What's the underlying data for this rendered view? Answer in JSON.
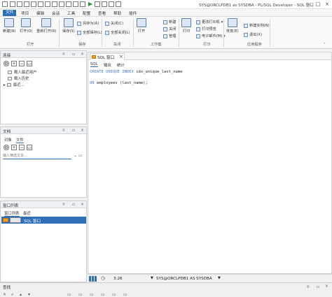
{
  "title": "SYS@ORCLPDB1 as SYSDBA - PL/SQL Developer - SQL 窗口",
  "menu": [
    "文件",
    "项目",
    "编辑",
    "会话",
    "工具",
    "配置",
    "查看",
    "帮助",
    "插件"
  ],
  "ribbon": {
    "new": "新建(N)",
    "open": "打开(O)",
    "reopen": "重新打开(R)",
    "save": "保存(S)",
    "save_as": "另存为(A)",
    "save_all": "全部保存(L)",
    "close": "关闭(C)",
    "close_all": "全部关闭(L)",
    "wb_open": "打开",
    "wb_new": "新建",
    "wb_close": "关闭",
    "wb_manage": "管理",
    "print": "打印",
    "change_printer": "更改打印机",
    "print_preview": "打印预览",
    "email": "电子邮件(M)",
    "recover": "恢复(E)",
    "new_instance": "新建实例(N)",
    "exit": "退出(X)",
    "groups": {
      "open": "打开",
      "save": "保存",
      "close": "关闭",
      "workspace": "工作集",
      "print": "打印",
      "app": "应用程序"
    }
  },
  "browser_panel": {
    "title": "连接",
    "items": [
      "载入最近用户",
      "载入历史",
      "最近..."
    ]
  },
  "files_panel": {
    "title": "文档",
    "tabs": [
      "对象",
      "文件"
    ],
    "filter_placeholder": "输入筛选文本..."
  },
  "window_list_panel": {
    "title": "窗口列表",
    "tabs": [
      "窗口列表",
      "最近"
    ],
    "items": [
      {
        "label": "SQL 窗口",
        "selected": true
      }
    ]
  },
  "editor": {
    "doc_tab": "SQL 窗口",
    "subtabs": [
      "SQL",
      "输出",
      "统计"
    ],
    "lines": [
      [
        "CREATE UNIQUE INDEX",
        " idx_unique_last_name"
      ],
      [
        "",
        ""
      ],
      [
        "ON",
        " employees (last_name);"
      ]
    ]
  },
  "status": {
    "position": "3:26",
    "connection": "SYS@ORCLPDB1 AS SYSDBA"
  },
  "findbar": {
    "title": "查找"
  },
  "colors": {
    "accent": "#2f6fb7",
    "keyword": "#4a74c9",
    "selection": "#2f6fb7"
  }
}
